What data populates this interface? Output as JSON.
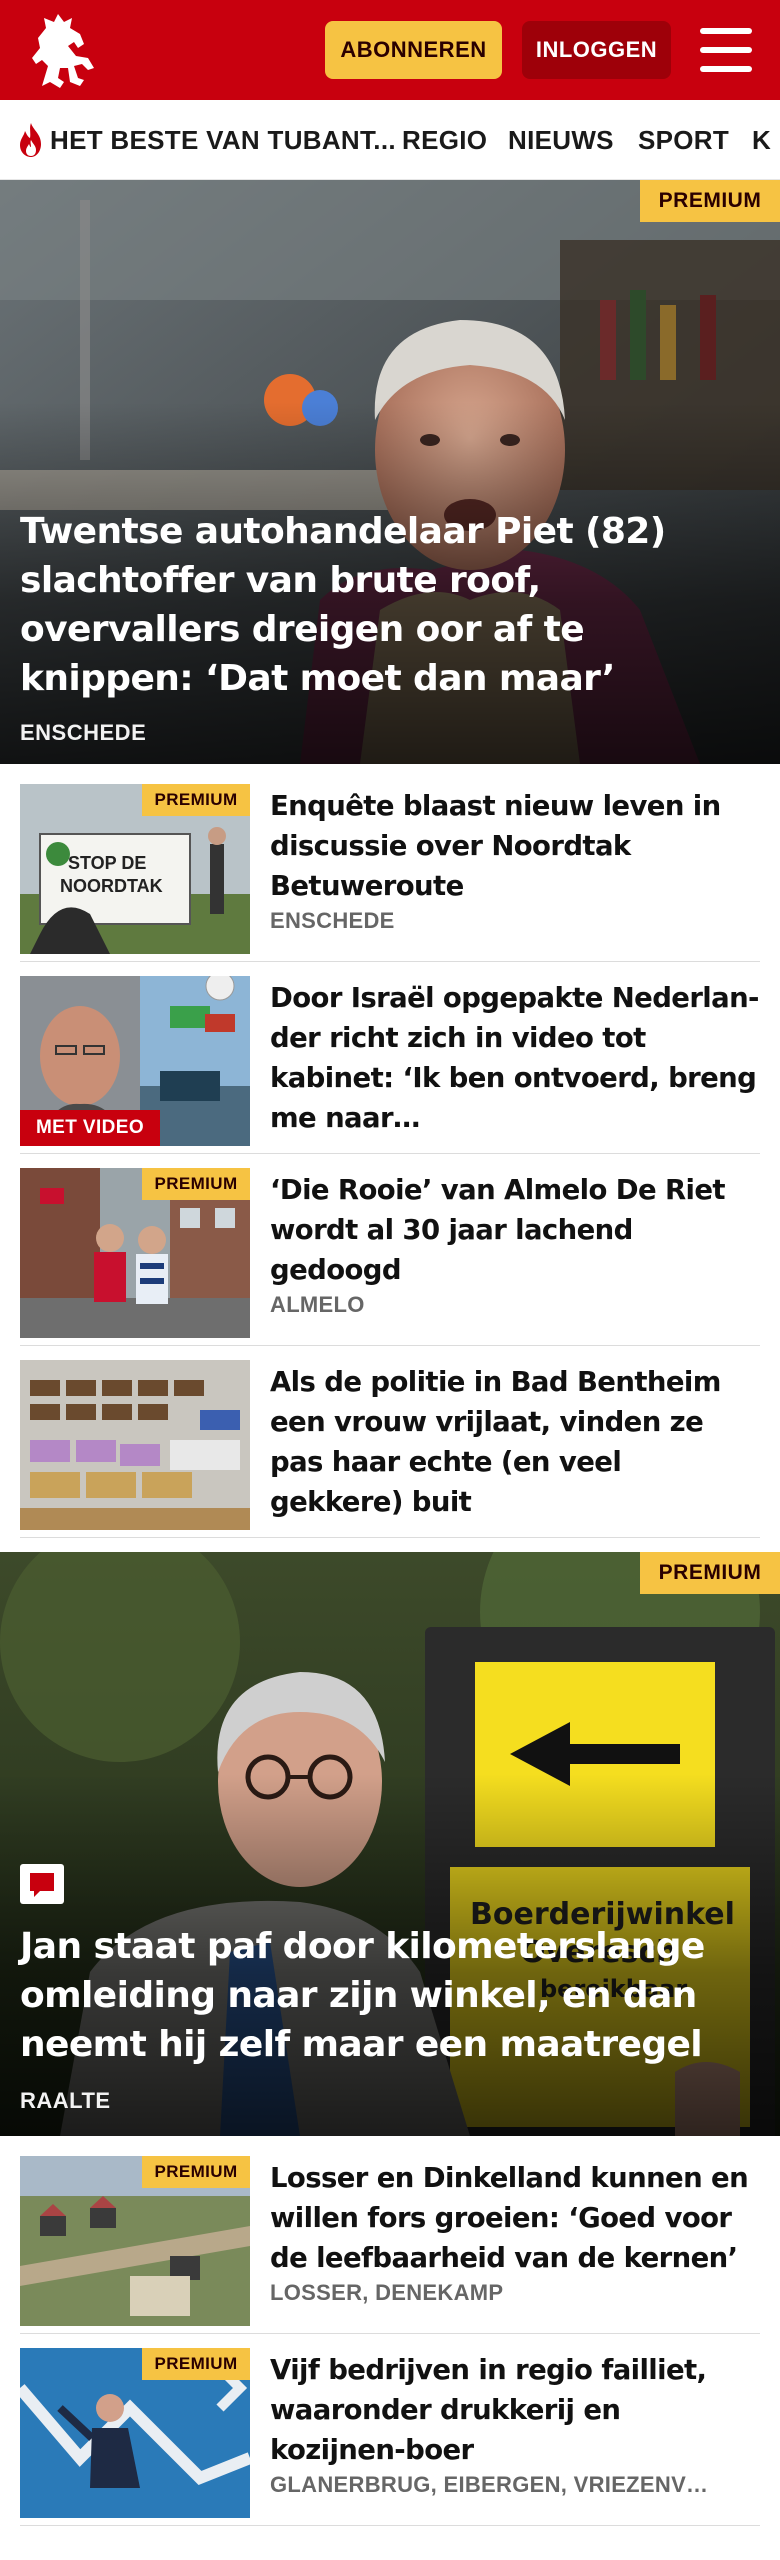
{
  "header": {
    "logo": "tubantia-horse-logo",
    "subscribe_label": "ABONNEREN",
    "login_label": "INLOGGEN",
    "menu_icon": "hamburger-menu-icon",
    "colors": {
      "brand": "#c8000e",
      "subscribe_bg": "#f6c343",
      "login_bg": "#9e0009"
    }
  },
  "nav": {
    "items": [
      {
        "label": "HET BESTE VAN TUBANT...",
        "icon": "flame-icon"
      },
      {
        "label": "REGIO"
      },
      {
        "label": "NIEUWS"
      },
      {
        "label": "SPORT"
      },
      {
        "label": "K"
      }
    ]
  },
  "premium_label": "PREMIUM",
  "video_label": "MET VIDEO",
  "articles": {
    "hero1": {
      "title": "Twentse autohandelaar Piet (82) slachtoffer van brute roof, overvallers dreigen oor af te knippen: ‘Dat moet dan maar’",
      "location": "ENSCHEDE",
      "premium": true
    },
    "list1": [
      {
        "title": "Enquête blaast nieuw leven in discussie over Noordtak Betuweroute",
        "location": "ENSCHEDE",
        "premium": true,
        "thumb_text": "STOP DE NOORDTAK"
      },
      {
        "title": "Door Israël opgepakte Nederlan-der richt zich in video tot kabinet: ‘Ik ben ontvoerd, breng me naar…",
        "location": "",
        "premium": false,
        "video": true
      },
      {
        "title": "‘Die Rooie’ van Almelo De Riet wordt al 30 jaar lachend gedoogd",
        "location": "ALMELO",
        "premium": true
      },
      {
        "title": "Als de politie in Bad Bentheim een vrouw vrijlaat, vinden ze pas haar echte (en veel gekkere) buit",
        "location": "",
        "premium": false
      }
    ],
    "hero2": {
      "title": "Jan staat paf door kilometerslange omleiding naar zijn winkel, en dan neemt hij zelf maar een maatregel",
      "location": "RAALTE",
      "premium": true,
      "sign_text": "Boerderijwinkel Overesch bereikbaar",
      "icon": "comment-icon"
    },
    "list2": [
      {
        "title": "Losser en Dinkelland kunnen en willen fors groeien: ‘Goed voor de leefbaarheid van de kernen’",
        "location": "LOSSER, DENEKAMP",
        "premium": true
      },
      {
        "title": "Vijf bedrijven in regio failliet, waaronder drukkerij en kozijnen-boer",
        "location": "GLANERBRUG, EIBERGEN, VRIEZENV…",
        "premium": true
      }
    ]
  }
}
